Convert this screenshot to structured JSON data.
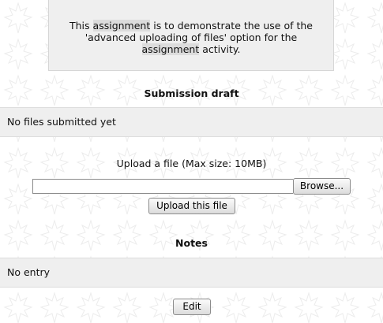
{
  "intro": {
    "line1_pre": "This ",
    "line1_hl": "assignment",
    "line1_post": " is to demonstrate the use of the",
    "line2": "'advanced uploading of files' option for the",
    "line3_hl": "assignment",
    "line3_post": " activity."
  },
  "submission": {
    "heading": "Submission draft",
    "status": "No files submitted yet"
  },
  "upload": {
    "label": "Upload a file (Max size: 10MB)",
    "file_value": "",
    "browse_label": "Browse...",
    "upload_button": "Upload this file"
  },
  "notes": {
    "heading": "Notes",
    "entry": "No entry",
    "edit_button": "Edit"
  }
}
